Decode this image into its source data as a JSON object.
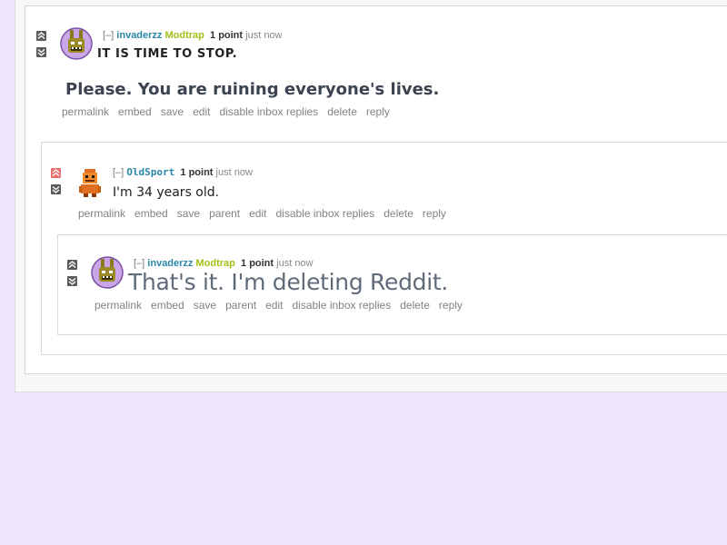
{
  "comments": [
    {
      "expand": "[–]",
      "author": "invaderzz",
      "flair": "Modtrap",
      "score": "1 point",
      "time": "just now",
      "lines": [
        "IT IS TIME TO STOP.",
        "Please. You are ruining everyone's lives."
      ],
      "buttons": [
        "permalink",
        "embed",
        "save",
        "edit",
        "disable inbox replies",
        "delete",
        "reply"
      ],
      "upvoted": false
    },
    {
      "expand": "[–]",
      "author": "OldSport",
      "score": "1 point",
      "time": "just now",
      "lines": [
        "I'm 34 years old."
      ],
      "buttons": [
        "permalink",
        "embed",
        "save",
        "parent",
        "edit",
        "disable inbox replies",
        "delete",
        "reply"
      ],
      "upvoted": true
    },
    {
      "expand": "[–]",
      "author": "invaderzz",
      "flair": "Modtrap",
      "score": "1 point",
      "time": "just now",
      "lines": [
        "That's it. I'm deleting Reddit."
      ],
      "buttons": [
        "permalink",
        "embed",
        "save",
        "parent",
        "edit",
        "disable inbox replies",
        "delete",
        "reply"
      ],
      "upvoted": false
    }
  ],
  "colors": {
    "page_background": "#f0e6fc",
    "author": "#2a86a8",
    "flair": "#a2c217",
    "upvote_active": "#e8706f",
    "button_text": "#828282"
  },
  "icons": [
    "upvote-arrow-icon",
    "downvote-arrow-icon",
    "springtrap-avatar-icon",
    "pixel-character-avatar-icon"
  ]
}
